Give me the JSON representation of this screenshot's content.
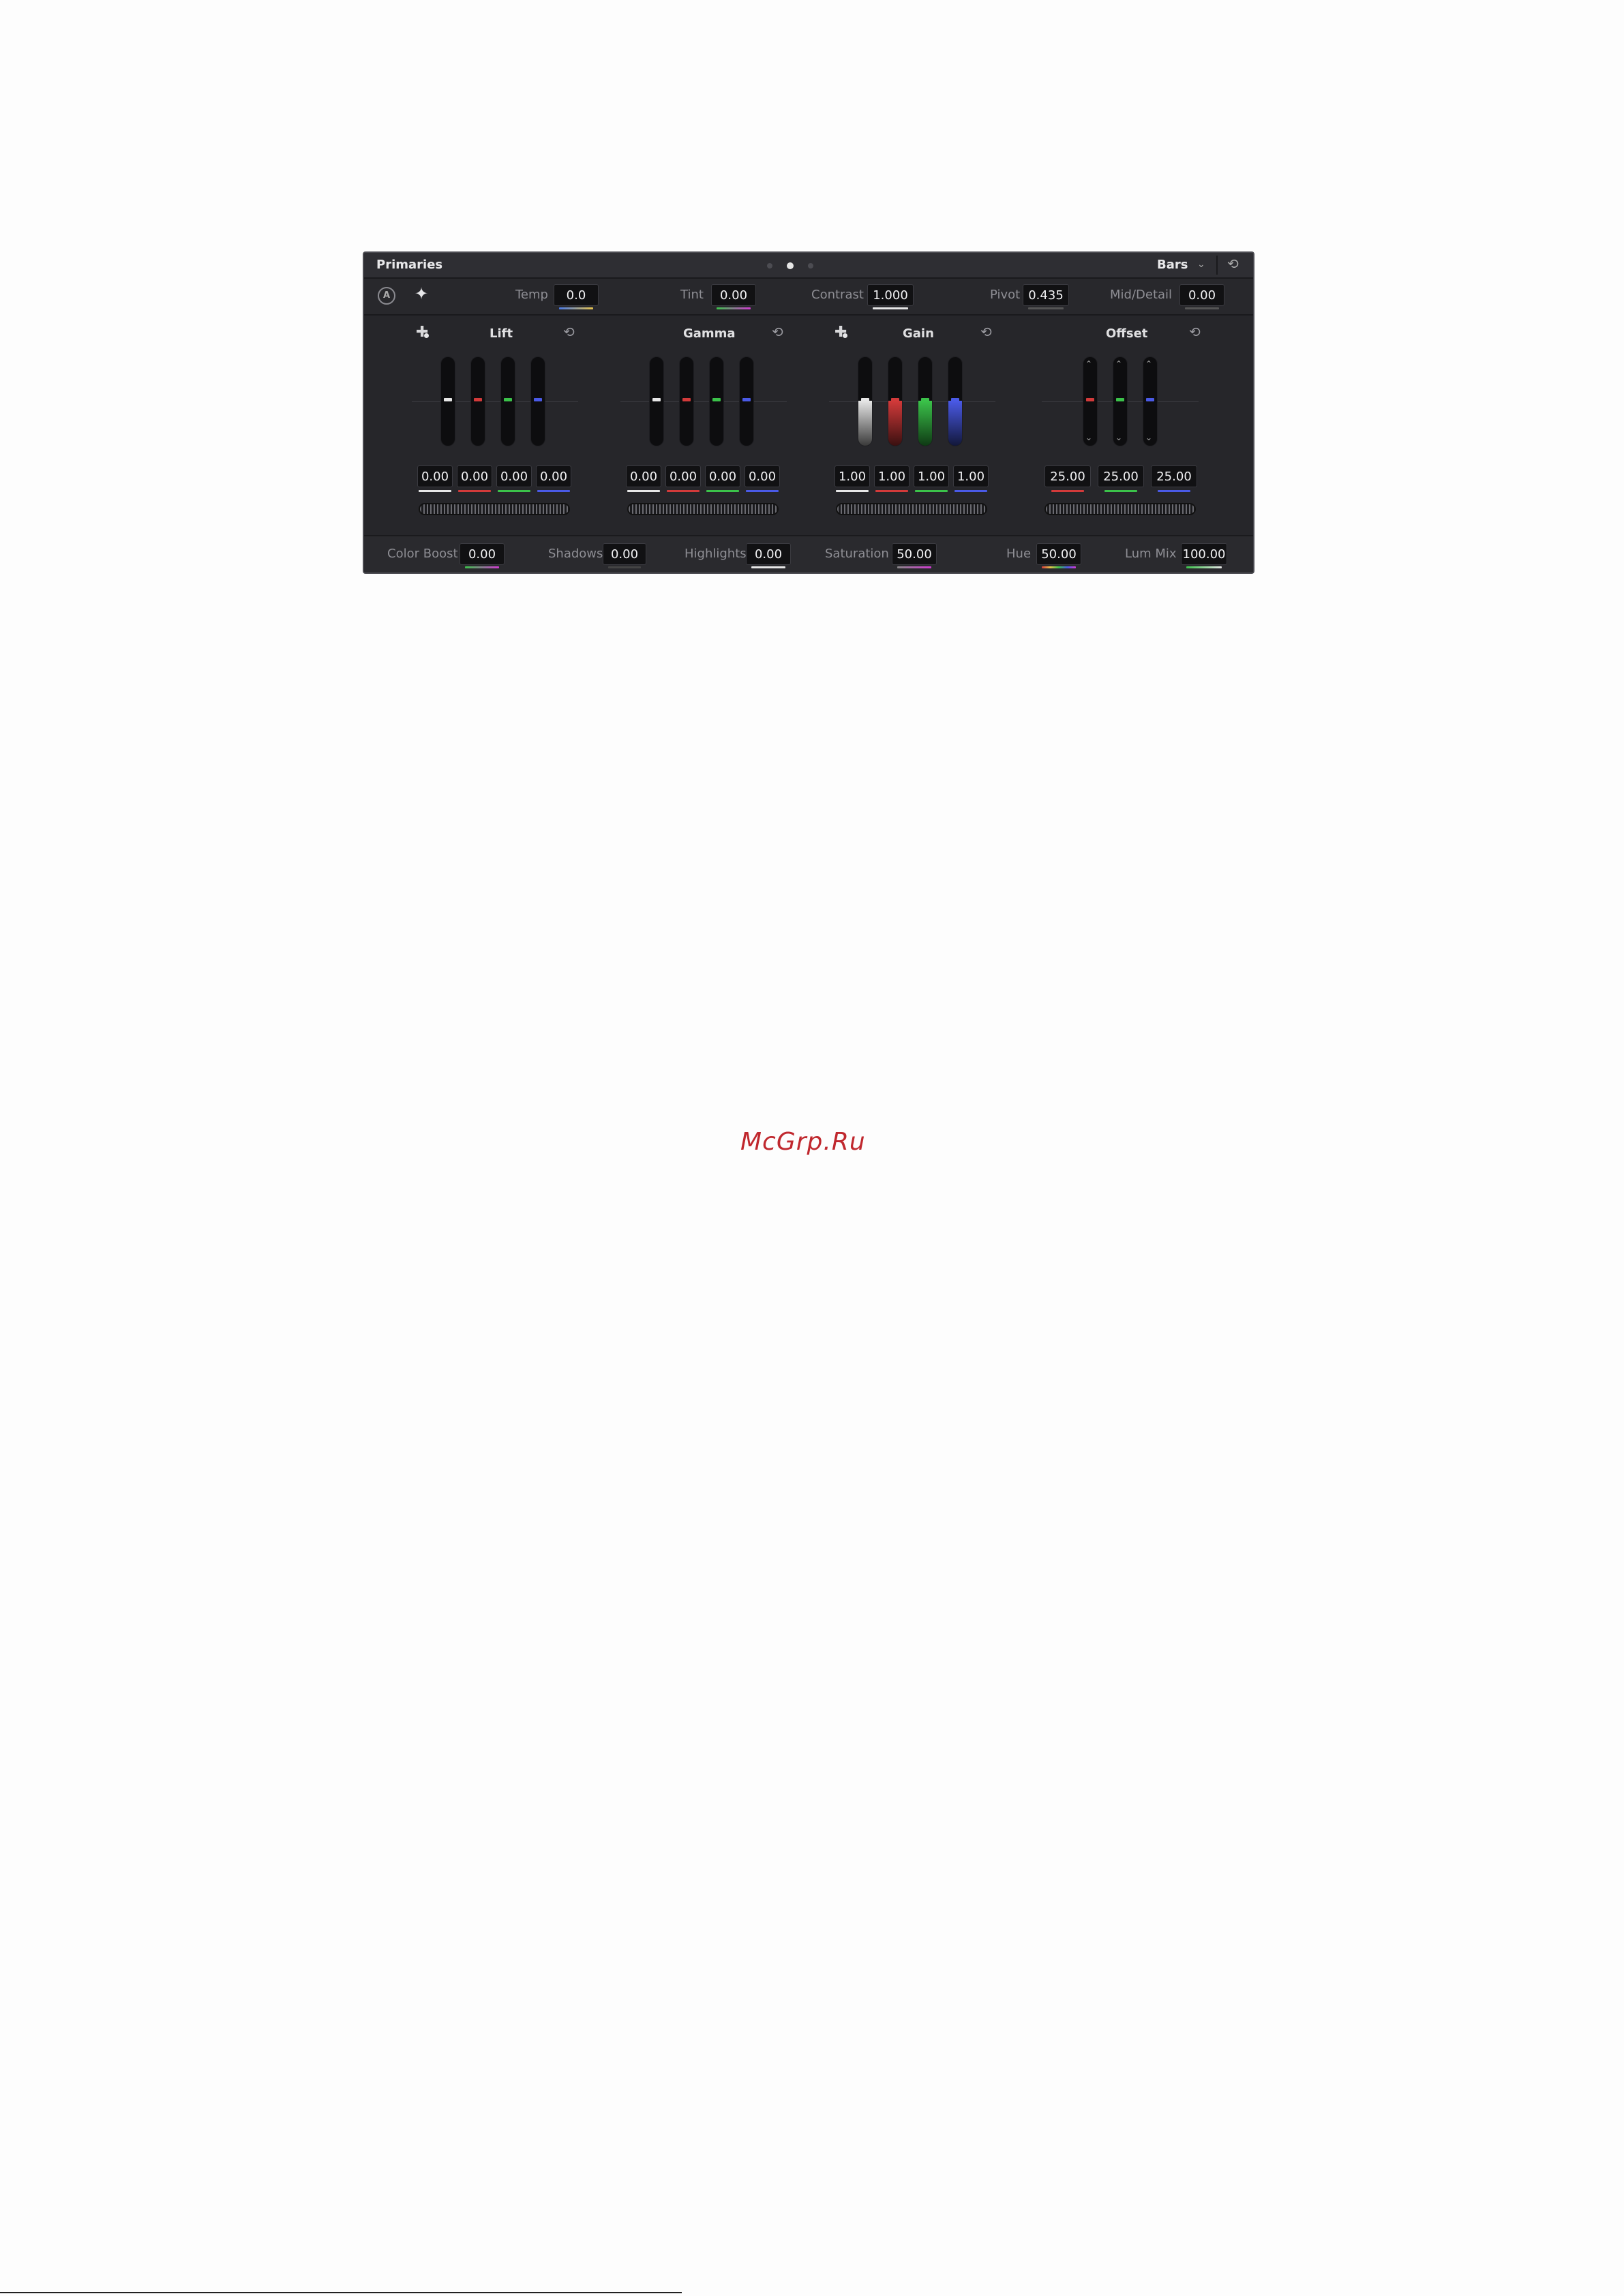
{
  "panel": {
    "title": "Primaries",
    "mode": "Bars",
    "pages": 3,
    "active_page": 1
  },
  "top_controls": [
    {
      "label": "Temp",
      "value": "0.0"
    },
    {
      "label": "Tint",
      "value": "0.00"
    },
    {
      "label": "Contrast",
      "value": "1.000"
    },
    {
      "label": "Pivot",
      "value": "0.435"
    },
    {
      "label": "Mid/Detail",
      "value": "0.00"
    }
  ],
  "wheels": [
    {
      "title": "Lift",
      "values": [
        "0.00",
        "0.00",
        "0.00",
        "0.00"
      ]
    },
    {
      "title": "Gamma",
      "values": [
        "0.00",
        "0.00",
        "0.00",
        "0.00"
      ]
    },
    {
      "title": "Gain",
      "values": [
        "1.00",
        "1.00",
        "1.00",
        "1.00"
      ]
    },
    {
      "title": "Offset",
      "values": [
        "25.00",
        "25.00",
        "25.00"
      ]
    }
  ],
  "bottom_controls": [
    {
      "label": "Color Boost",
      "value": "0.00"
    },
    {
      "label": "Shadows",
      "value": "0.00"
    },
    {
      "label": "Highlights",
      "value": "0.00"
    },
    {
      "label": "Saturation",
      "value": "50.00"
    },
    {
      "label": "Hue",
      "value": "50.00"
    },
    {
      "label": "Lum Mix",
      "value": "100.00"
    }
  ],
  "channel_colors": {
    "y": "#e6e6e6",
    "r": "#d23a3a",
    "g": "#3bc24a",
    "b": "#4a5ae6"
  },
  "icons": {
    "auto": "auto-balance-icon",
    "picker": "color-picker-icon",
    "reset": "reset-icon",
    "crosshair": "crosshair-picker-icon"
  },
  "watermark": "McGrp.Ru"
}
